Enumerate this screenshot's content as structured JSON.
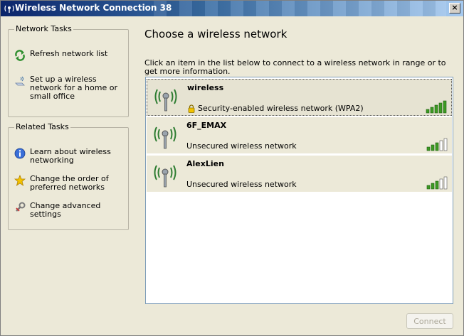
{
  "window": {
    "title": "Wireless Network Connection 38",
    "close_glyph": "×"
  },
  "sidebar": {
    "network_tasks": {
      "title": "Network Tasks",
      "items": [
        {
          "label": "Refresh network list",
          "icon": "refresh-icon"
        },
        {
          "label": "Set up a wireless network for a home or small office",
          "icon": "setup-network-icon"
        }
      ]
    },
    "related_tasks": {
      "title": "Related Tasks",
      "items": [
        {
          "label": "Learn about wireless networking",
          "icon": "info-icon"
        },
        {
          "label": "Change the order of preferred networks",
          "icon": "star-icon"
        },
        {
          "label": "Change advanced settings",
          "icon": "wrench-icon"
        }
      ]
    }
  },
  "main": {
    "title": "Choose a wireless network",
    "instructions": "Click an item in the list below to connect to a wireless network in range or to get more information.",
    "networks": [
      {
        "ssid": "wireless",
        "status": "Security-enabled wireless network (WPA2)",
        "secured": true,
        "signal_bars": 5,
        "selected": true
      },
      {
        "ssid": "6F_EMAX",
        "status": "Unsecured wireless network",
        "secured": false,
        "signal_bars": 3,
        "selected": false
      },
      {
        "ssid": "AlexLien",
        "status": "Unsecured wireless network",
        "secured": false,
        "signal_bars": 3,
        "selected": false
      }
    ],
    "connect_label": "Connect"
  },
  "colors": {
    "signal_on": "#3c9a23",
    "signal_off": "#ffffff",
    "title_bar": "#0a246a"
  }
}
